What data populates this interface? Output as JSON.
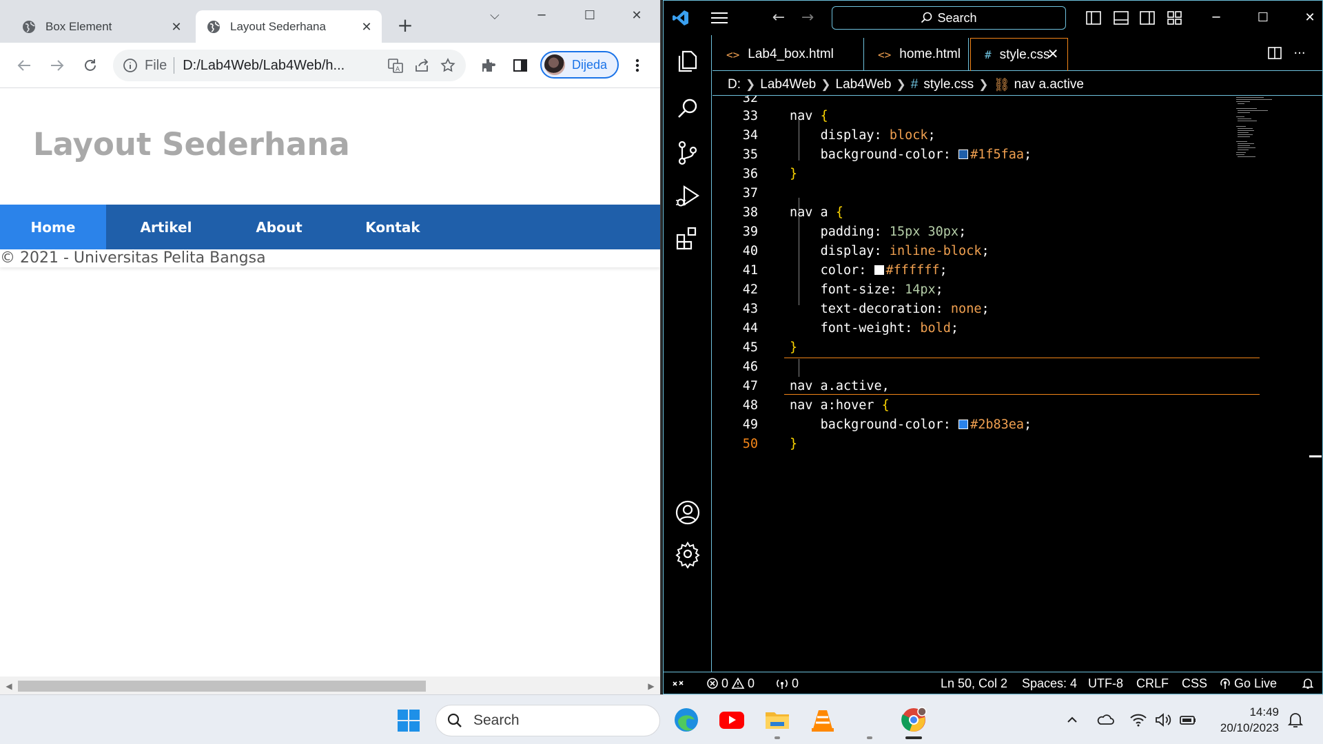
{
  "chrome": {
    "tabs": [
      {
        "title": "Box Element",
        "active": false
      },
      {
        "title": "Layout Sederhana",
        "active": true
      }
    ],
    "address": {
      "scheme": "File",
      "url": "D:/Lab4Web/Lab4Web/h..."
    },
    "profile_name": "Dijeda",
    "page": {
      "title": "Layout Sederhana",
      "nav": [
        "Home",
        "Artikel",
        "About",
        "Kontak"
      ],
      "active_nav": "Home",
      "footer": "© 2021 - Universitas Pelita Bangsa"
    }
  },
  "vscode": {
    "search_label": "Search",
    "tabs": [
      {
        "label": "Lab4_box.html",
        "icon": "html-icon"
      },
      {
        "label": "home.html",
        "icon": "html-icon"
      },
      {
        "label": "style.css",
        "icon": "css-icon",
        "active": true
      }
    ],
    "breadcrumb": {
      "drive": "D:",
      "folder1": "Lab4Web",
      "folder2": "Lab4Web",
      "file": "style.css",
      "symbol": "nav a.active"
    },
    "line_numbers": [
      "32",
      "33",
      "34",
      "35",
      "36",
      "37",
      "38",
      "39",
      "40",
      "41",
      "42",
      "43",
      "44",
      "45",
      "46",
      "47",
      "48",
      "49",
      "50"
    ],
    "code": {
      "sel_nav": "nav",
      "sel_nav_a": "nav a",
      "sel_active": "nav a.active,",
      "sel_hover": "nav a:hover",
      "open": "{",
      "close": "}",
      "display": "display:",
      "block": "block",
      "bg": "background-color:",
      "hex1": "#1f5faa",
      "padding": "padding:",
      "pad_val": "15px 30px",
      "inline": "inline-block",
      "color": "color:",
      "hex_white": "#ffffff",
      "font_size": "font-size:",
      "fs_val": "14px",
      "text_deco": "text-decoration:",
      "none": "none",
      "font_weight": "font-weight:",
      "bold": "bold",
      "hex2": "#2b83ea",
      "semi": ";"
    },
    "colors": {
      "swatch1": "#1f5faa",
      "swatch_white": "#ffffff",
      "swatch2": "#2b83ea"
    },
    "status": {
      "errors": "0",
      "warnings": "0",
      "ports": "0",
      "position": "Ln 50, Col 2",
      "spaces": "Spaces: 4",
      "encoding": "UTF-8",
      "eol": "CRLF",
      "language": "CSS",
      "live": "Go Live"
    }
  },
  "taskbar": {
    "search_label": "Search",
    "time": "14:49",
    "date": "20/10/2023"
  }
}
